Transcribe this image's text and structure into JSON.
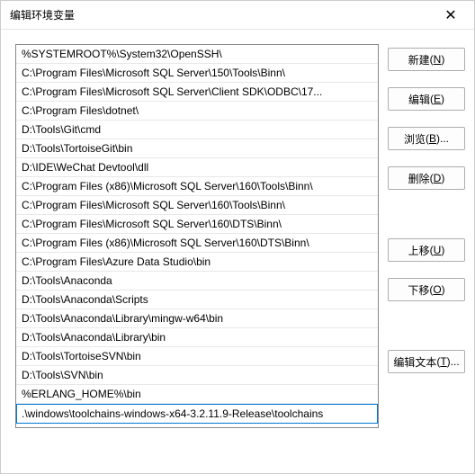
{
  "window": {
    "title": "编辑环境变量",
    "close_glyph": "✕"
  },
  "entries": [
    "%SYSTEMROOT%\\System32\\OpenSSH\\",
    "C:\\Program Files\\Microsoft SQL Server\\150\\Tools\\Binn\\",
    "C:\\Program Files\\Microsoft SQL Server\\Client SDK\\ODBC\\17...",
    "C:\\Program Files\\dotnet\\",
    "D:\\Tools\\Git\\cmd",
    "D:\\Tools\\TortoiseGit\\bin",
    "D:\\IDE\\WeChat Devtool\\dll",
    "C:\\Program Files (x86)\\Microsoft SQL Server\\160\\Tools\\Binn\\",
    "C:\\Program Files\\Microsoft SQL Server\\160\\Tools\\Binn\\",
    "C:\\Program Files\\Microsoft SQL Server\\160\\DTS\\Binn\\",
    "C:\\Program Files (x86)\\Microsoft SQL Server\\160\\DTS\\Binn\\",
    "C:\\Program Files\\Azure Data Studio\\bin",
    "D:\\Tools\\Anaconda",
    "D:\\Tools\\Anaconda\\Scripts",
    "D:\\Tools\\Anaconda\\Library\\mingw-w64\\bin",
    "D:\\Tools\\Anaconda\\Library\\bin",
    "D:\\Tools\\TortoiseSVN\\bin",
    "D:\\Tools\\SVN\\bin",
    "%ERLANG_HOME%\\bin",
    ".\\windows\\toolchains-windows-x64-3.2.11.9-Release\\toolchains"
  ],
  "selected_index": 19,
  "buttons": {
    "new": {
      "text": "新建",
      "accel": "N"
    },
    "edit": {
      "text": "编辑",
      "accel": "E"
    },
    "browse": {
      "text": "浏览",
      "accel": "B",
      "ellipsis": "..."
    },
    "delete": {
      "text": "删除",
      "accel": "D"
    },
    "moveup": {
      "text": "上移",
      "accel": "U"
    },
    "movedown": {
      "text": "下移",
      "accel": "O"
    },
    "edittext": {
      "text": "编辑文本",
      "accel": "T",
      "ellipsis": "..."
    }
  }
}
